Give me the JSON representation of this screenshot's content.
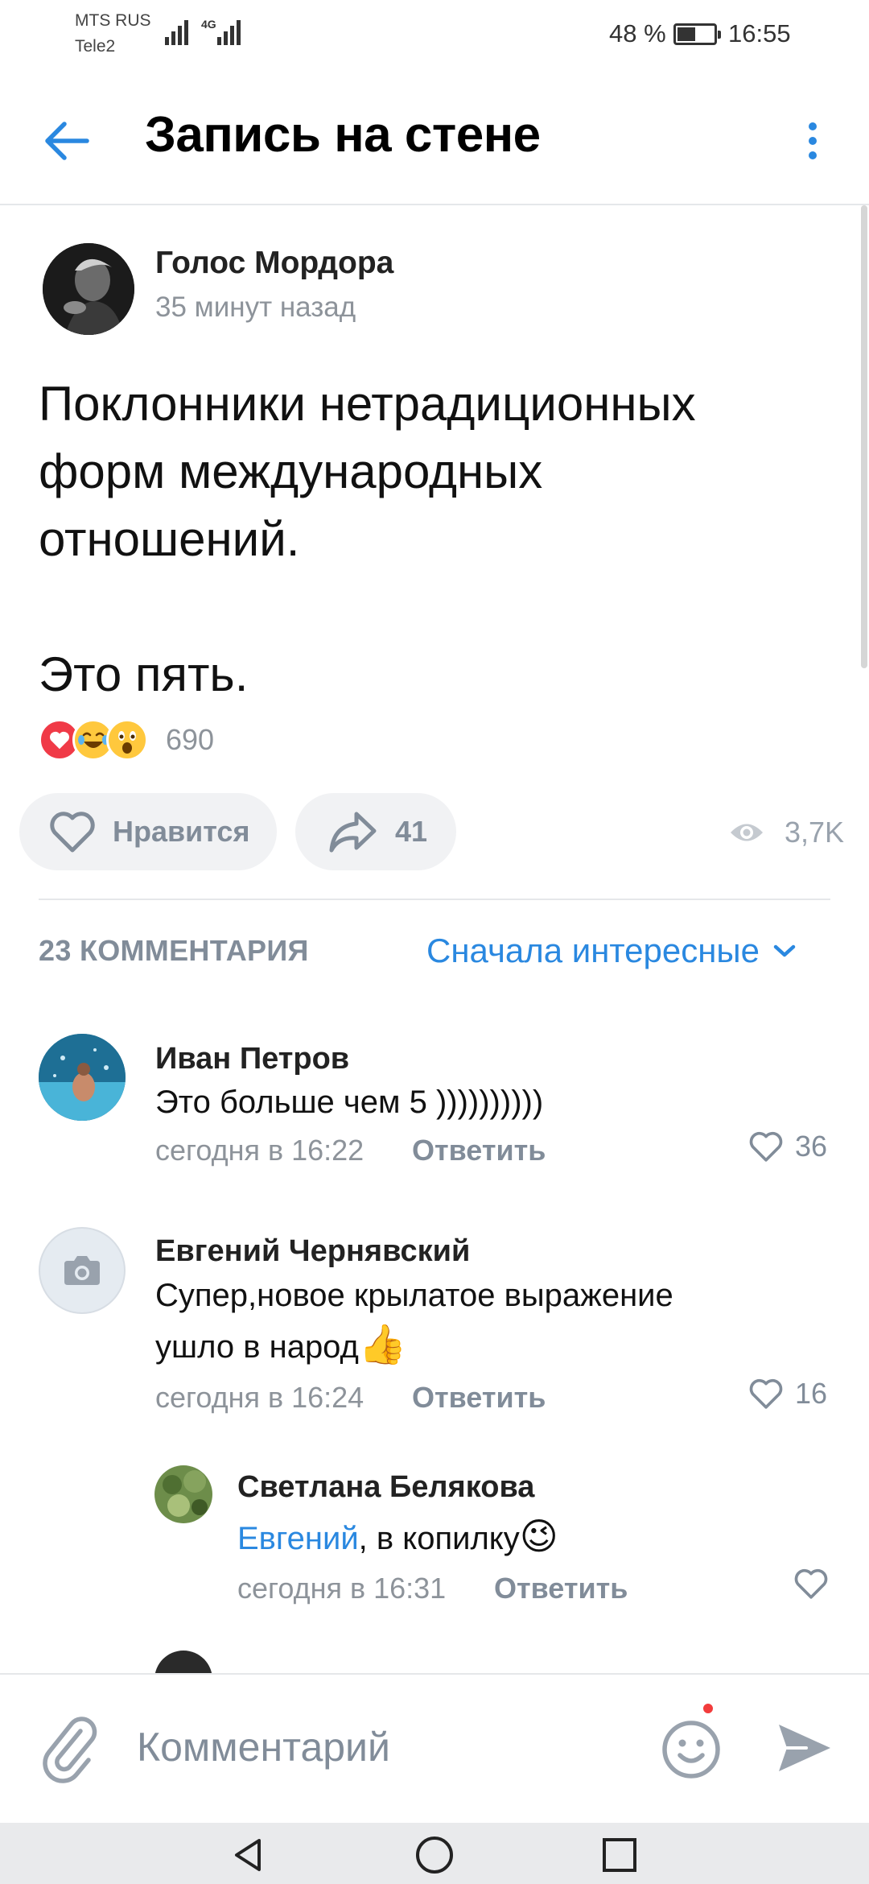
{
  "status_bar": {
    "carrier_primary": "MTS RUS",
    "carrier_secondary": "Tele2",
    "network": "4G",
    "battery_percent": "48 %",
    "time": "16:55"
  },
  "header": {
    "title": "Запись на стене"
  },
  "post": {
    "author": "Голос Мордора",
    "time": "35 минут назад",
    "text": "Поклонники нетрадиционных\nформ международных\nотношений.\n\nЭто пять.",
    "reactions": [
      "heart",
      "laughing-tears",
      "surprised"
    ],
    "reactions_count": "690",
    "like_label": "Нравится",
    "shares_count": "41",
    "views_count": "3,7K"
  },
  "comments_section": {
    "count_label": "23 КОММЕНТАРИЯ",
    "sort_label": "Сначала интересные"
  },
  "comments": [
    {
      "name": "Иван Петров",
      "text": "Это больше чем 5 ))))))))))",
      "time": "сегодня в 16:22",
      "reply_label": "Ответить",
      "likes": "36"
    },
    {
      "name": "Евгений Чернявский",
      "text_line1": "Супер,новое крылатое выражение",
      "text_line2": "ушло в народ",
      "emoji": "👍",
      "time": "сегодня в 16:24",
      "reply_label": "Ответить",
      "likes": "16"
    },
    {
      "name": "Светлана Белякова",
      "mention": "Евгений",
      "text": ", в копилку",
      "emoji": "😉",
      "time": "сегодня в 16:31",
      "reply_label": "Ответить",
      "likes": ""
    }
  ],
  "input": {
    "placeholder": "Комментарий"
  },
  "colors": {
    "accent": "#2a88e0",
    "secondary_text": "#818c99",
    "pill_background": "#f1f2f4",
    "notification_dot": "#f23c3c"
  },
  "icons": [
    "arrow-left-icon",
    "more-vertical-icon",
    "heart-icon",
    "share-icon",
    "eye-icon",
    "chevron-down-icon",
    "paperclip-icon",
    "smile-icon",
    "send-icon",
    "camera-icon",
    "nav-back-icon",
    "nav-home-icon",
    "nav-recents-icon"
  ]
}
